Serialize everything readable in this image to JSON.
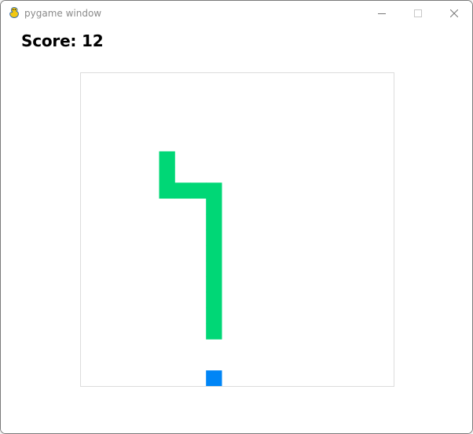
{
  "window": {
    "title": "pygame window",
    "icon": "pygame-snake-icon",
    "controls": [
      "minimize-icon",
      "maximize-icon",
      "close-icon"
    ]
  },
  "game": {
    "score_label": "Score: 12",
    "score": 12,
    "grid": {
      "cols": 20,
      "rows": 20
    },
    "colors": {
      "snake": "#00d776",
      "food": "#0085f6",
      "board_border": "#dcdcdc",
      "background": "#ffffff"
    },
    "snake_cells": [
      [
        5,
        5
      ],
      [
        5,
        6
      ],
      [
        5,
        7
      ],
      [
        6,
        7
      ],
      [
        7,
        7
      ],
      [
        8,
        7
      ],
      [
        8,
        8
      ],
      [
        8,
        9
      ],
      [
        8,
        10
      ],
      [
        8,
        11
      ],
      [
        8,
        12
      ],
      [
        8,
        13
      ],
      [
        8,
        14
      ],
      [
        8,
        15
      ],
      [
        8,
        16
      ]
    ],
    "food_cell": [
      8,
      19
    ]
  }
}
